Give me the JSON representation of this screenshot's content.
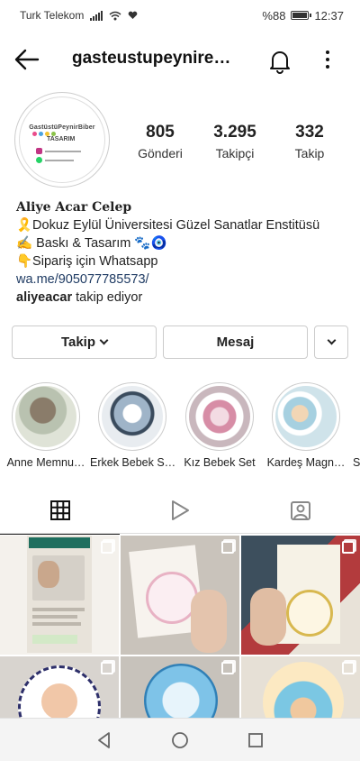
{
  "status_bar": {
    "carrier": "Turk Telekom",
    "battery_percent": "%88",
    "time": "12:37"
  },
  "header": {
    "username": "gasteustupeynire…"
  },
  "profile": {
    "avatar": {
      "title_line1": "GastüstüPeynirBiber",
      "title_line2": "TASARIM"
    },
    "stats": [
      {
        "value": "805",
        "label": "Gönderi"
      },
      {
        "value": "3.295",
        "label": "Takipçi"
      },
      {
        "value": "332",
        "label": "Takip"
      }
    ],
    "bio": {
      "name": "Aliye Acar Celep",
      "line1": "🎗️Dokuz Eylül Üniversitesi Güzel Sanatlar Enstitüsü",
      "line2": "✍️ Baskı & Tasarım 🐾🧿",
      "line3": "👇Sipariş için Whatsapp",
      "link": "wa.me/905077785573/",
      "followed_by_user": "aliyeacar",
      "followed_by_text": "takip ediyor"
    }
  },
  "actions": {
    "follow_label": "Takip",
    "message_label": "Mesaj"
  },
  "highlights": [
    {
      "label": "Anne Memnu…",
      "color": "#c9d6c8"
    },
    {
      "label": "Erkek Bebek S…",
      "color": "#cfd9e6"
    },
    {
      "label": "Kız Bebek Set",
      "color": "#e8d6dc"
    },
    {
      "label": "Kardeş Magn…",
      "color": "#d7e6ea"
    }
  ],
  "tabs": [
    {
      "name": "grid-tab",
      "icon": "grid-icon",
      "active": true
    },
    {
      "name": "reels-tab",
      "icon": "play-icon",
      "active": false
    },
    {
      "name": "tagged-tab",
      "icon": "tagged-person-icon",
      "active": false
    }
  ],
  "colors": {
    "link": "#1f3b63",
    "border": "#cccccc",
    "nav_bg": "#f4f4f4"
  }
}
